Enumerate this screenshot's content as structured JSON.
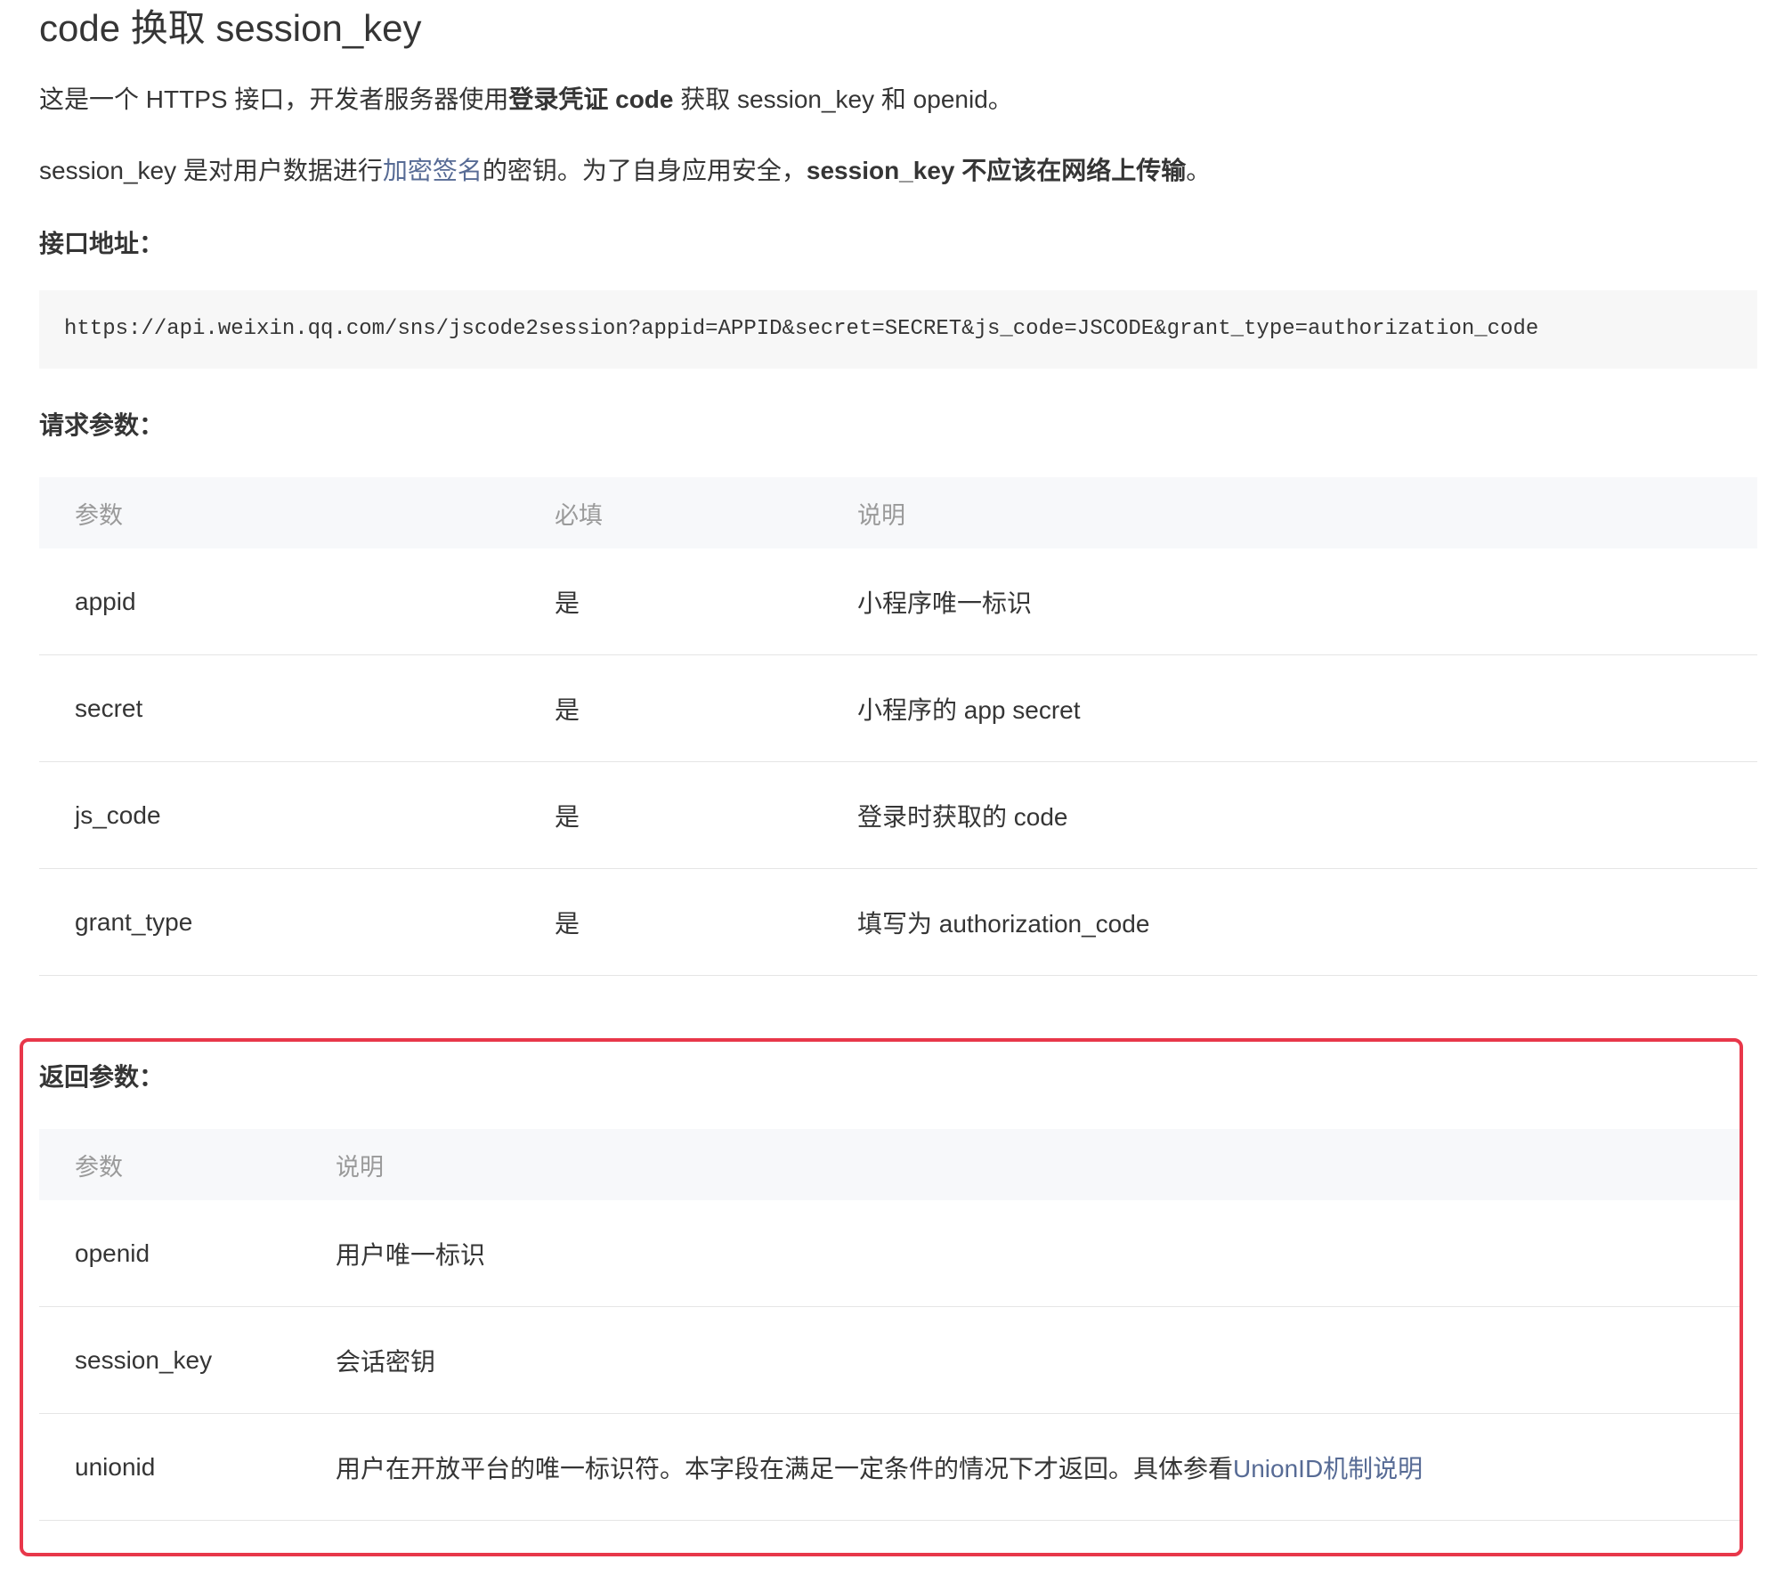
{
  "title": "code 换取 session_key",
  "intro": {
    "p1_prefix": "这是一个 HTTPS 接口，开发者服务器使用",
    "p1_bold": "登录凭证 code",
    "p1_suffix": " 获取 session_key 和 openid。",
    "p2_prefix": "session_key 是对用户数据进行",
    "p2_link": "加密签名",
    "p2_middle": "的密钥。为了自身应用安全，",
    "p2_bold": "session_key 不应该在网络上传输",
    "p2_suffix": "。"
  },
  "endpoint": {
    "label": "接口地址：",
    "url": "https://api.weixin.qq.com/sns/jscode2session?appid=APPID&secret=SECRET&js_code=JSCODE&grant_type=authorization_code"
  },
  "request_params": {
    "label": "请求参数：",
    "headers": [
      "参数",
      "必填",
      "说明"
    ],
    "rows": [
      {
        "param": "appid",
        "required": "是",
        "desc": "小程序唯一标识"
      },
      {
        "param": "secret",
        "required": "是",
        "desc": "小程序的 app secret"
      },
      {
        "param": "js_code",
        "required": "是",
        "desc": "登录时获取的 code"
      },
      {
        "param": "grant_type",
        "required": "是",
        "desc": "填写为 authorization_code"
      }
    ]
  },
  "response_params": {
    "label": "返回参数：",
    "headers": [
      "参数",
      "说明"
    ],
    "rows": [
      {
        "param": "openid",
        "desc": "用户唯一标识"
      },
      {
        "param": "session_key",
        "desc": "会话密钥"
      },
      {
        "param": "unionid",
        "desc": "用户在开放平台的唯一标识符。本字段在满足一定条件的情况下才返回。具体参看",
        "link": "UnionID机制说明"
      }
    ]
  },
  "colors": {
    "link": "#576b95",
    "highlight_border": "#e8374a",
    "table_header_bg": "#f7f8fa",
    "code_bg": "#f7f7f7"
  }
}
